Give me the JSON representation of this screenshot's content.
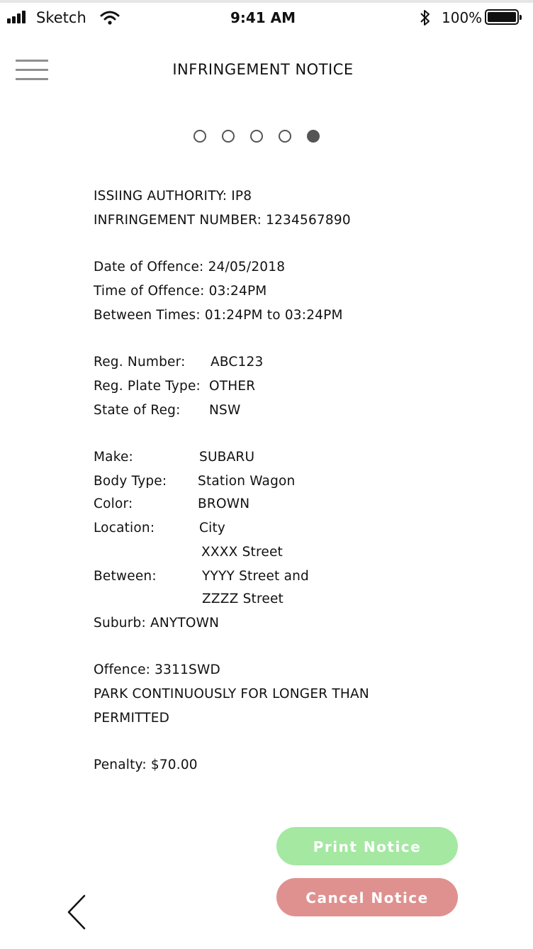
{
  "status_bar": {
    "carrier": "Sketch",
    "time": "9:41 AM",
    "battery_pct": "100%"
  },
  "header": {
    "title": "INFRINGEMENT NOTICE"
  },
  "pager": {
    "total": 5,
    "active_index": 5
  },
  "notice": {
    "issuing_authority": "ISSIING AUTHORITY: IP8",
    "infringement_number": "INFRINGEMENT NUMBER: 1234567890",
    "date_of_offence": "Date of Offence: 24/05/2018",
    "time_of_offence": "Time of Offence: 03:24PM",
    "between_times": "Between Times: 01:24PM to 03:24PM",
    "reg_number_label": "Reg. Number:",
    "reg_number_value": "ABC123",
    "reg_plate_type_label": "Reg. Plate Type:",
    "reg_plate_type_value": "OTHER",
    "state_label": "State of Reg:",
    "state_value": "NSW",
    "make_label": "Make:",
    "make_value": "SUBARU",
    "body_type_label": "Body Type:",
    "body_type_value": "Station Wagon",
    "color_label": "Color:",
    "color_value": "BROWN",
    "location_label": "Location:",
    "location_value_1": "City",
    "location_value_2": "XXXX Street",
    "between_label": "Between:",
    "between_value_1": "YYYY Street and",
    "between_value_2": "ZZZZ Street",
    "suburb": "Suburb: ANYTOWN",
    "offence": "Offence:  3311SWD",
    "offence_desc_1": "PARK CONTINUOUSLY FOR LONGER THAN",
    "offence_desc_2": "PERMITTED",
    "penalty": "Penalty: $70.00"
  },
  "actions": {
    "print_label": "Print Notice",
    "cancel_label": "Cancel Notice"
  },
  "icons": {
    "menu": "hamburger-icon",
    "back": "chevron-left-icon",
    "wifi": "wifi-icon",
    "bluetooth": "bluetooth-icon",
    "battery": "battery-icon",
    "signal": "signal-icon"
  },
  "colors": {
    "print_button": "#a4e8a2",
    "cancel_button": "#df918f",
    "active_dot": "#555555"
  }
}
